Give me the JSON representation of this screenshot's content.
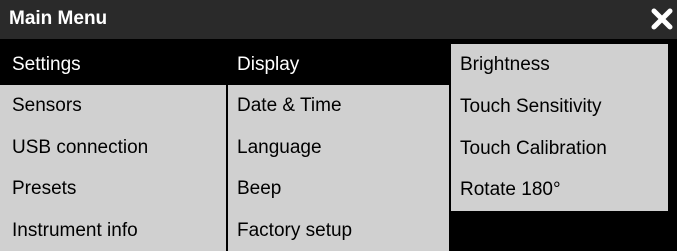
{
  "title_bar": {
    "title": "Main Menu",
    "close_icon": "close-x-icon"
  },
  "menu": {
    "column_1": {
      "items": [
        {
          "label": "Settings",
          "selected": true
        },
        {
          "label": "Sensors",
          "selected": false
        },
        {
          "label": "USB connection",
          "selected": false
        },
        {
          "label": "Presets",
          "selected": false
        },
        {
          "label": "Instrument info",
          "selected": false
        }
      ]
    },
    "column_2": {
      "items": [
        {
          "label": "Display",
          "selected": true
        },
        {
          "label": "Date & Time",
          "selected": false
        },
        {
          "label": "Language",
          "selected": false
        },
        {
          "label": "Beep",
          "selected": false
        },
        {
          "label": "Factory setup",
          "selected": false
        }
      ]
    },
    "column_3": {
      "items": [
        {
          "label": "Brightness",
          "selected": false
        },
        {
          "label": "Touch Sensitivity",
          "selected": false
        },
        {
          "label": "Touch Calibration",
          "selected": false
        },
        {
          "label": "Rotate 180°",
          "selected": false
        }
      ]
    }
  },
  "colors": {
    "background": "#000000",
    "title_bar": "#2a2a2a",
    "menu_item_bg": "#d0d0d0",
    "selected_bg": "#000000",
    "selected_text": "#ffffff",
    "text": "#000000"
  }
}
